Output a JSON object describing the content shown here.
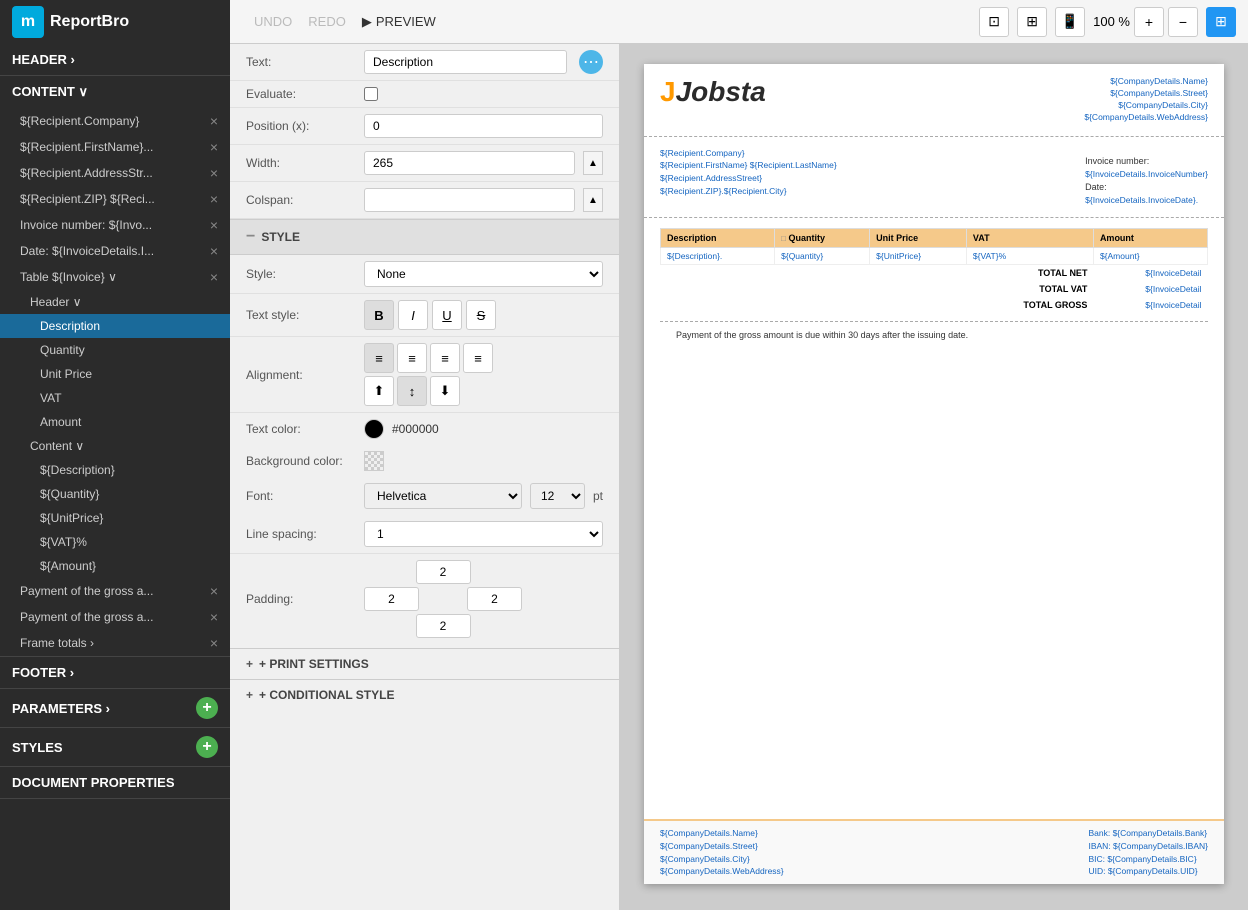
{
  "app": {
    "name": "ReportBro"
  },
  "toolbar": {
    "undo_label": "UNDO",
    "redo_label": "REDO",
    "preview_label": "PREVIEW",
    "zoom": "100 %",
    "icons": [
      "⊞",
      "⊟",
      "▭",
      "📱"
    ]
  },
  "sidebar": {
    "sections": [
      {
        "label": "HEADER ›",
        "key": "header"
      },
      {
        "label": "CONTENT ∨",
        "key": "content"
      }
    ],
    "content_items": [
      {
        "label": "${Recipient.Company}",
        "close": true,
        "indent": 0
      },
      {
        "label": "${Recipient.FirstName}...",
        "close": true,
        "indent": 0
      },
      {
        "label": "${Recipient.AddressStr...",
        "close": true,
        "indent": 0
      },
      {
        "label": "${Recipient.ZIP} ${Reci...",
        "close": true,
        "indent": 0
      },
      {
        "label": "Invoice number: ${Invo...",
        "close": true,
        "indent": 0
      },
      {
        "label": "Date: ${InvoiceDetails.I...",
        "close": true,
        "indent": 0
      },
      {
        "label": "Table ${Invoice} ∨",
        "close": true,
        "indent": 0
      },
      {
        "label": "Header ∨",
        "close": false,
        "indent": 1
      },
      {
        "label": "Description",
        "close": false,
        "indent": 2,
        "selected": true
      },
      {
        "label": "Quantity",
        "close": false,
        "indent": 2
      },
      {
        "label": "Unit Price",
        "close": false,
        "indent": 2
      },
      {
        "label": "VAT",
        "close": false,
        "indent": 2
      },
      {
        "label": "Amount",
        "close": false,
        "indent": 2
      },
      {
        "label": "Content ∨",
        "close": false,
        "indent": 1
      },
      {
        "label": "${Description}",
        "close": false,
        "indent": 2
      },
      {
        "label": "${Quantity}",
        "close": false,
        "indent": 2
      },
      {
        "label": "${UnitPrice}",
        "close": false,
        "indent": 2
      },
      {
        "label": "${VAT}%",
        "close": false,
        "indent": 2
      },
      {
        "label": "${Amount}",
        "close": false,
        "indent": 2
      },
      {
        "label": "Payment of the gross a...",
        "close": true,
        "indent": 0
      },
      {
        "label": "Payment of the gross a...",
        "close": true,
        "indent": 0
      },
      {
        "label": "Frame totals ›",
        "close": true,
        "indent": 0
      }
    ],
    "footer_label": "FOOTER ›",
    "parameters_label": "PARAMETERS ›",
    "styles_label": "STYLES",
    "doc_props_label": "DOCUMENT PROPERTIES"
  },
  "properties": {
    "text_label": "Text:",
    "text_value": "Description",
    "evaluate_label": "Evaluate:",
    "position_label": "Position (x):",
    "position_value": "0",
    "width_label": "Width:",
    "width_value": "265",
    "colspan_label": "Colspan:",
    "colspan_value": "",
    "style_section": "STYLE",
    "style_label": "Style:",
    "style_value": "None",
    "text_style_label": "Text style:",
    "bold_label": "B",
    "italic_label": "I",
    "underline_label": "U",
    "strikethrough_label": "S",
    "alignment_label": "Alignment:",
    "text_color_label": "Text color:",
    "text_color_value": "#000000",
    "bg_color_label": "Background color:",
    "font_label": "Font:",
    "font_value": "Helvetica",
    "font_size_value": "12",
    "font_pt_label": "pt",
    "line_spacing_label": "Line spacing:",
    "line_spacing_value": "1",
    "padding_label": "Padding:",
    "padding_top": "2",
    "padding_left": "2",
    "padding_right": "2",
    "padding_bottom": "2",
    "print_settings_label": "+ PRINT SETTINGS",
    "conditional_style_label": "+ CONDITIONAL STYLE"
  },
  "document": {
    "logo_text": "Jobsta",
    "company_name": "${CompanyDetails.Name}",
    "company_street": "${CompanyDetails.Street}",
    "company_city": "${CompanyDetails.City}",
    "company_web": "${CompanyDetails.WebAddress}",
    "recipient_company": "${Recipient.Company}",
    "recipient_name": "${Recipient.FirstName} ${Recipient.LastName}",
    "recipient_address": "${Recipient.AddressStreet}",
    "recipient_zip_city": "${Recipient.ZIP}.${Recipient.City}",
    "invoice_number_label": "Invoice number:",
    "invoice_number_value": "${InvoiceDetails.InvoiceNumber}",
    "invoice_date_label": "Date:",
    "invoice_date_value": "${InvoiceDetails.InvoiceDate}.",
    "table_headers": [
      "Description",
      "Quantity",
      "Unit Price",
      "VAT",
      "Amount"
    ],
    "table_row": [
      "${Description}.",
      "${Quantity}",
      "${UnitPrice}",
      "${VAT}%",
      "${Amount}"
    ],
    "total_net_label": "TOTAL NET",
    "total_net_value": "${InvoiceDetail",
    "total_vat_label": "TOTAL VAT",
    "total_vat_value": "${InvoiceDetail",
    "total_gross_label": "TOTAL GROSS",
    "total_gross_value": "${InvoiceDetail",
    "payment_text": "Payment of the gross amount is due within 30 days after the issuing date.",
    "footer_left_line1": "${CompanyDetails.Name}",
    "footer_left_line2": "${CompanyDetails.Street}",
    "footer_left_line3": "${CompanyDetails.City}",
    "footer_left_line4": "${CompanyDetails.WebAddress}",
    "footer_right_line1": "Bank: ${CompanyDetails.Bank}",
    "footer_right_line2": "IBAN: ${CompanyDetails.IBAN}",
    "footer_right_line3": "BIC: ${CompanyDetails.BIC}",
    "footer_right_line4": "UID: ${CompanyDetails.UID}"
  }
}
